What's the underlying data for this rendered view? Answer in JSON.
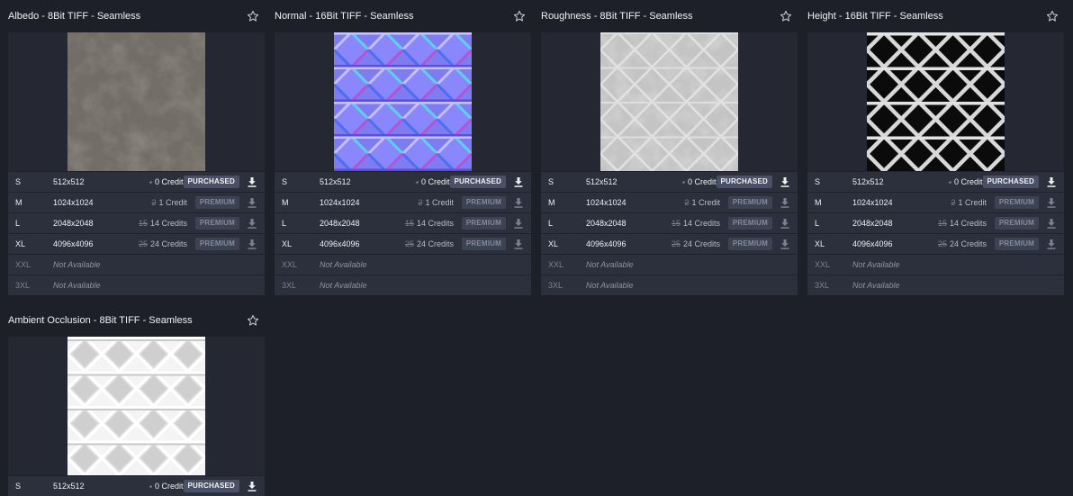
{
  "cards": [
    {
      "title": "Albedo - 8Bit TIFF - Seamless",
      "thumb": "albedo",
      "rows": [
        {
          "size": "S",
          "dim": "512x512",
          "old": "",
          "credits": "0 Credits",
          "badge": "PURCHASED",
          "status": "purchased"
        },
        {
          "size": "M",
          "dim": "1024x1024",
          "old": "2",
          "credits": "1 Credit",
          "badge": "PREMIUM",
          "status": "premium"
        },
        {
          "size": "L",
          "dim": "2048x2048",
          "old": "15",
          "credits": "14 Credits",
          "badge": "PREMIUM",
          "status": "premium"
        },
        {
          "size": "XL",
          "dim": "4096x4096",
          "old": "25",
          "credits": "24 Credits",
          "badge": "PREMIUM",
          "status": "premium"
        },
        {
          "size": "XXL",
          "dim": "Not Available",
          "status": "na"
        },
        {
          "size": "3XL",
          "dim": "Not Available",
          "status": "na"
        }
      ]
    },
    {
      "title": "Normal - 16Bit TIFF - Seamless",
      "thumb": "normal",
      "rows": [
        {
          "size": "S",
          "dim": "512x512",
          "old": "",
          "credits": "0 Credits",
          "badge": "PURCHASED",
          "status": "purchased"
        },
        {
          "size": "M",
          "dim": "1024x1024",
          "old": "2",
          "credits": "1 Credit",
          "badge": "PREMIUM",
          "status": "premium"
        },
        {
          "size": "L",
          "dim": "2048x2048",
          "old": "15",
          "credits": "14 Credits",
          "badge": "PREMIUM",
          "status": "premium"
        },
        {
          "size": "XL",
          "dim": "4096x4096",
          "old": "25",
          "credits": "24 Credits",
          "badge": "PREMIUM",
          "status": "premium"
        },
        {
          "size": "XXL",
          "dim": "Not Available",
          "status": "na"
        },
        {
          "size": "3XL",
          "dim": "Not Available",
          "status": "na"
        }
      ]
    },
    {
      "title": "Roughness - 8Bit TIFF - Seamless",
      "thumb": "roughness",
      "rows": [
        {
          "size": "S",
          "dim": "512x512",
          "old": "",
          "credits": "0 Credits",
          "badge": "PURCHASED",
          "status": "purchased"
        },
        {
          "size": "M",
          "dim": "1024x1024",
          "old": "2",
          "credits": "1 Credit",
          "badge": "PREMIUM",
          "status": "premium"
        },
        {
          "size": "L",
          "dim": "2048x2048",
          "old": "15",
          "credits": "14 Credits",
          "badge": "PREMIUM",
          "status": "premium"
        },
        {
          "size": "XL",
          "dim": "4096x4096",
          "old": "25",
          "credits": "24 Credits",
          "badge": "PREMIUM",
          "status": "premium"
        },
        {
          "size": "XXL",
          "dim": "Not Available",
          "status": "na"
        },
        {
          "size": "3XL",
          "dim": "Not Available",
          "status": "na"
        }
      ]
    },
    {
      "title": "Height - 16Bit TIFF - Seamless",
      "thumb": "height",
      "rows": [
        {
          "size": "S",
          "dim": "512x512",
          "old": "",
          "credits": "0 Credits",
          "badge": "PURCHASED",
          "status": "purchased"
        },
        {
          "size": "M",
          "dim": "1024x1024",
          "old": "2",
          "credits": "1 Credit",
          "badge": "PREMIUM",
          "status": "premium"
        },
        {
          "size": "L",
          "dim": "2048x2048",
          "old": "15",
          "credits": "14 Credits",
          "badge": "PREMIUM",
          "status": "premium"
        },
        {
          "size": "XL",
          "dim": "4096x4096",
          "old": "25",
          "credits": "24 Credits",
          "badge": "PREMIUM",
          "status": "premium"
        },
        {
          "size": "XXL",
          "dim": "Not Available",
          "status": "na"
        },
        {
          "size": "3XL",
          "dim": "Not Available",
          "status": "na"
        }
      ]
    },
    {
      "title": "Ambient Occlusion - 8Bit TIFF - Seamless",
      "thumb": "ao",
      "rows": [
        {
          "size": "S",
          "dim": "512x512",
          "old": "",
          "credits": "0 Credits",
          "badge": "PURCHASED",
          "status": "purchased"
        }
      ]
    }
  ],
  "icons": {
    "favorite": "star-outline-icon",
    "download": "download-icon"
  },
  "colors": {
    "background": "#1e2029",
    "row": "#2c303d",
    "purchased_badge": "#4a5066",
    "premium_badge": "#3e4353"
  }
}
